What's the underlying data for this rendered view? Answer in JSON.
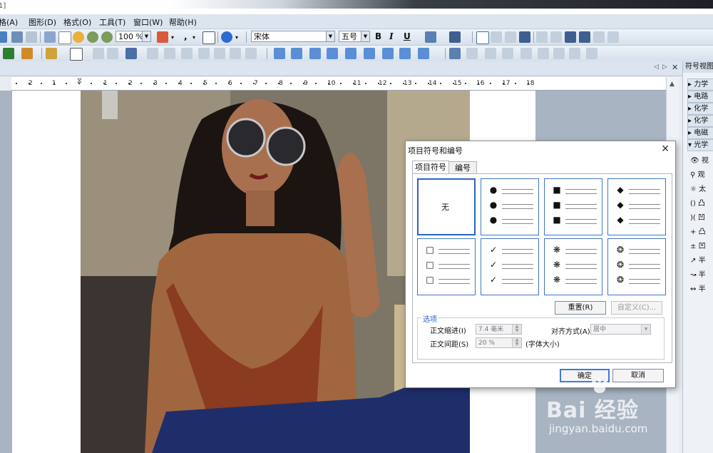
{
  "window": {
    "title_fragment": "1]"
  },
  "menubar": [
    "格(A)",
    "图形(D)",
    "格式(O)",
    "工具(T)",
    "窗口(W)",
    "帮助(H)"
  ],
  "toolbar1": {
    "zoom": "100 %",
    "font_name": "宋体",
    "font_size": "五号",
    "bold": "B",
    "italic": "I",
    "underline": "U"
  },
  "ruler": {
    "ticks": [
      "2",
      "1",
      "1",
      "2",
      "3",
      "4",
      "5",
      "6",
      "7",
      "8",
      "9",
      "10",
      "11",
      "12",
      "13",
      "14",
      "15",
      "16",
      "17",
      "18"
    ]
  },
  "side_panel": {
    "title": "符号视图",
    "categories": [
      "力学",
      "电路",
      "化学",
      "化学",
      "电磁",
      "光学"
    ],
    "symbols": [
      "视",
      "观",
      "太",
      "凸",
      "凹",
      "凸",
      "凹",
      "半",
      "半",
      "半"
    ]
  },
  "dialog": {
    "title": "项目符号和编号",
    "tabs": [
      "项目符号",
      "编号"
    ],
    "active_tab": 0,
    "bullet_styles": [
      {
        "symbol": "无",
        "selected": true
      },
      {
        "symbol": "●",
        "selected": false
      },
      {
        "symbol": "■",
        "selected": false
      },
      {
        "symbol": "◆",
        "selected": false
      },
      {
        "symbol": "□",
        "selected": false
      },
      {
        "symbol": "✓",
        "selected": false
      },
      {
        "symbol": "❋",
        "selected": false
      },
      {
        "symbol": "❂",
        "selected": false
      }
    ],
    "reset_button": "重置(R)",
    "customize_button": "自定义(C)...",
    "options_group": "选项",
    "indent_label": "正文缩进(I)",
    "indent_value": "7.4 毫米",
    "align_label": "对齐方式(A)",
    "align_value": "居中",
    "spacing_label": "正文间距(S)",
    "spacing_value": "20 %",
    "spacing_unit": "(字体大小)",
    "ok_button": "确定",
    "cancel_button": "取消"
  },
  "watermark": {
    "brand": "Bai  经验",
    "url": "jingyan.baidu.com"
  },
  "colors": {
    "accent": "#3d7bd8",
    "menubar": "#dbe4ef",
    "doc_bg": "#a9b4c2"
  }
}
